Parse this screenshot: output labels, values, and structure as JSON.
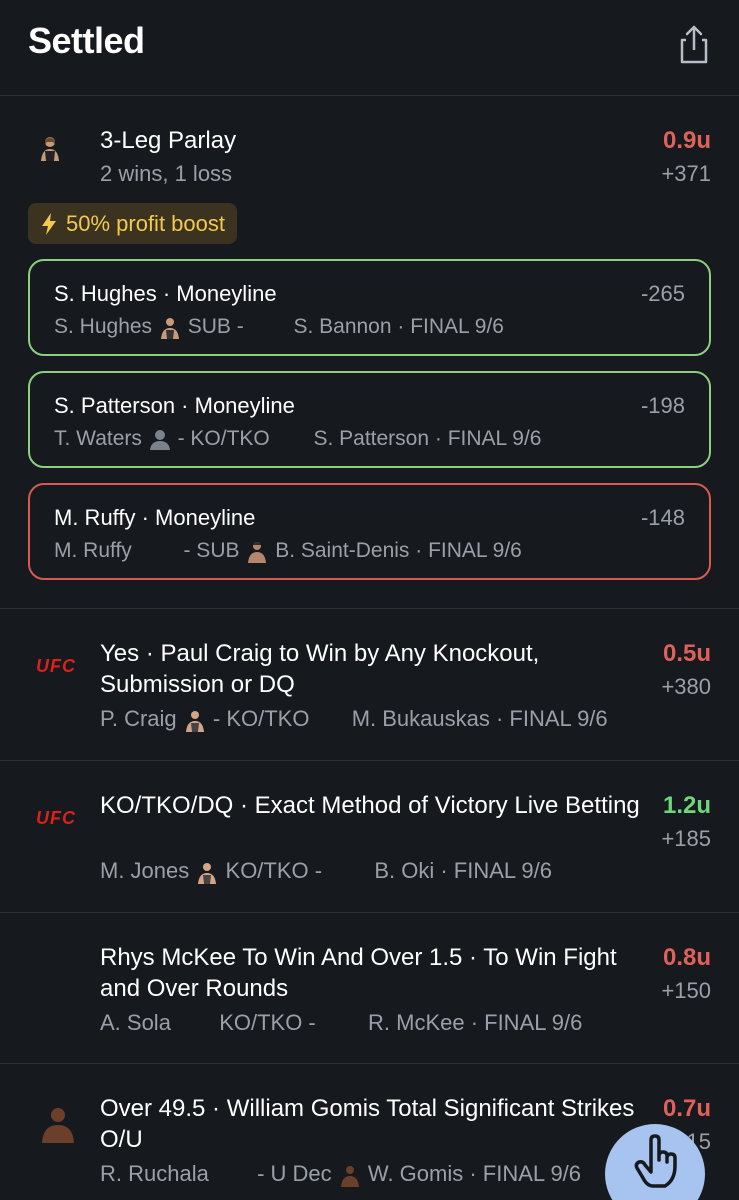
{
  "header": {
    "title": "Settled",
    "share_icon": "share-icon"
  },
  "parlay": {
    "title": "3-Leg Parlay",
    "record": "2 wins, 1 loss",
    "stake": "0.9u",
    "odds": "+371",
    "boost": "50% profit boost",
    "legs": [
      {
        "pick": "S. Hughes · Moneyline",
        "odds": "-265",
        "left": "S. Hughes",
        "method": "SUB -",
        "right": "S. Bannon · FINAL 9/6",
        "result": "win"
      },
      {
        "pick": "S. Patterson · Moneyline",
        "odds": "-198",
        "left": "T. Waters",
        "method": "- KO/TKO",
        "right": "S. Patterson · FINAL 9/6",
        "result": "win"
      },
      {
        "pick": "M. Ruffy · Moneyline",
        "odds": "-148",
        "left": "M. Ruffy",
        "method": "- SUB",
        "right": "B. Saint-Denis · FINAL 9/6",
        "result": "loss"
      }
    ]
  },
  "bets": [
    {
      "logo": "UFC",
      "title": "Yes · Paul Craig to Win by Any Knockout, Submission or DQ",
      "stake": "0.5u",
      "odds": "+380",
      "left": "P. Craig",
      "method": "- KO/TKO",
      "right": "M. Bukauskas · FINAL 9/6"
    },
    {
      "logo": "UFC",
      "title": "KO/TKO/DQ · Exact Method of Victory Live Betting",
      "stake": "1.2u",
      "odds": "+185",
      "left": "M. Jones",
      "method": "KO/TKO -",
      "right": "B. Oki · FINAL 9/6"
    },
    {
      "logo": "",
      "title": "Rhys McKee To Win And Over 1.5 · To Win Fight and Over Rounds",
      "stake": "0.8u",
      "odds": "+150",
      "left": "A. Sola",
      "method": "KO/TKO -",
      "right": "R. McKee · FINAL 9/6"
    },
    {
      "logo": "",
      "title": "Over 49.5 · William Gomis Total Significant Strikes O/U",
      "stake": "0.7u",
      "odds": "+115",
      "left": "R. Ruchala",
      "method": "- U Dec",
      "right": "W. Gomis · FINAL 9/6"
    }
  ],
  "colors": {
    "background": "#16191e",
    "win": "#6fd67a",
    "loss": "#e0605a",
    "boost": "#f2c94c",
    "fab": "#a7c3f0"
  },
  "fab": {
    "icon": "hand-pointer-icon"
  }
}
